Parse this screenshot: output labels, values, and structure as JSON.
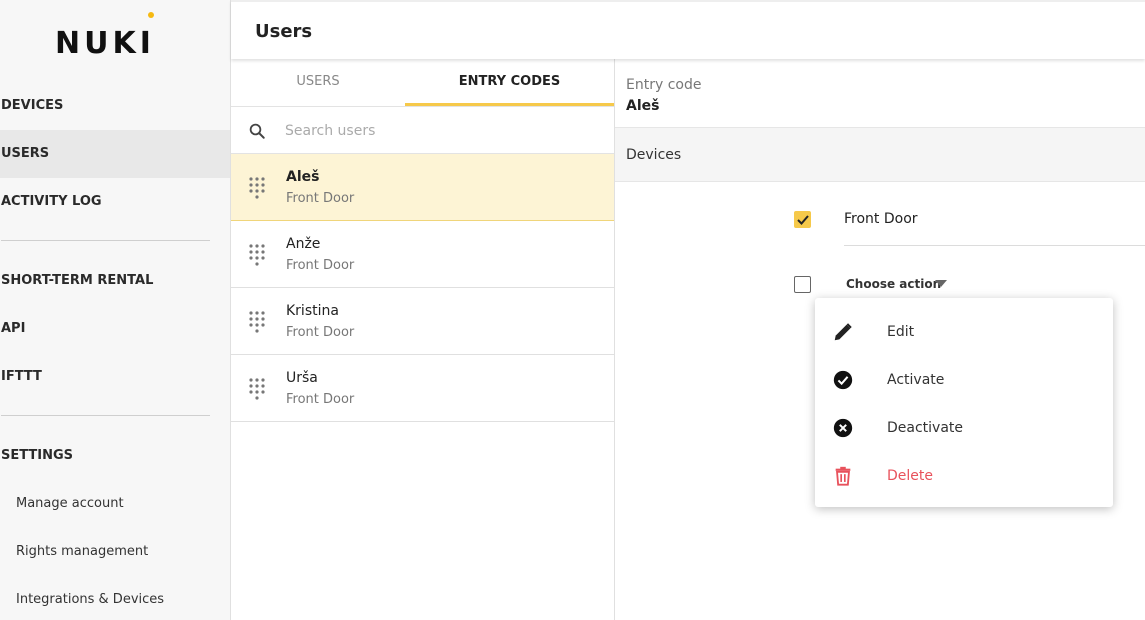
{
  "brand": {
    "logo_text": "NUKI",
    "accent": "#f6b911"
  },
  "sidebar": {
    "items": [
      {
        "label": "DEVICES"
      },
      {
        "label": "USERS"
      },
      {
        "label": "ACTIVITY LOG"
      },
      {
        "label": "SHORT-TERM RENTAL"
      },
      {
        "label": "API"
      },
      {
        "label": "IFTTT"
      },
      {
        "label": "SETTINGS"
      }
    ],
    "settings_items": [
      {
        "label": "Manage account"
      },
      {
        "label": "Rights management"
      },
      {
        "label": "Integrations & Devices"
      }
    ]
  },
  "header": {
    "title": "Users"
  },
  "tabs": [
    {
      "label": "USERS"
    },
    {
      "label": "ENTRY CODES"
    }
  ],
  "search": {
    "placeholder": "Search users",
    "value": ""
  },
  "list": [
    {
      "name": "Aleš",
      "device": "Front Door"
    },
    {
      "name": "Anže",
      "device": "Front Door"
    },
    {
      "name": "Kristina",
      "device": "Front Door"
    },
    {
      "name": "Urša",
      "device": "Front Door"
    }
  ],
  "detail": {
    "entry_code_label": "Entry code",
    "entry_code_value": "Aleš",
    "devices_label": "Devices",
    "device_name": "Front Door",
    "choose_action_label": "Choose action"
  },
  "menu": {
    "items": [
      {
        "label": "Edit",
        "icon": "pencil-icon"
      },
      {
        "label": "Activate",
        "icon": "check-circle-icon"
      },
      {
        "label": "Deactivate",
        "icon": "x-circle-icon"
      },
      {
        "label": "Delete",
        "icon": "trash-icon",
        "color": "#e8525c"
      }
    ]
  }
}
